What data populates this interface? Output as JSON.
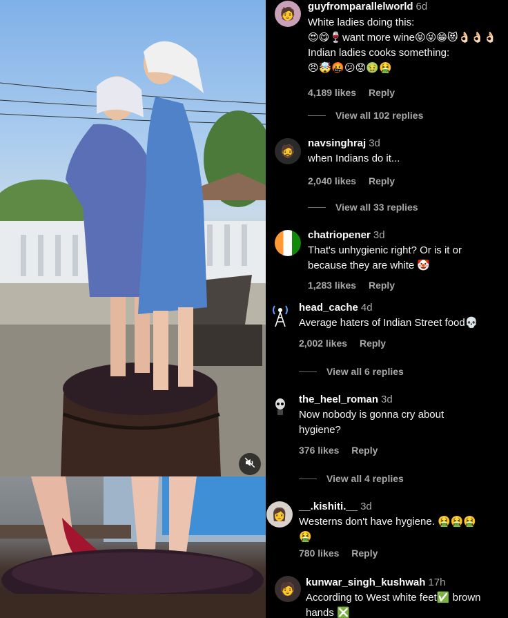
{
  "video": {
    "mute_icon": "speaker-muted-icon"
  },
  "comments": [
    {
      "username": "guyfromparallelworld",
      "time": "6d",
      "lines": [
        "White ladies doing this:",
        "😍😋🍷want more wine😝😜😁😻👌🏻👌🏻👌🏻",
        "Indian ladies cooks something:",
        "😠🤯🤬😕😟🤢🤮"
      ],
      "likes": "4,189 likes",
      "reply_label": "Reply",
      "view_replies": "View all 102 replies",
      "avatar_color": "#c8a0b8"
    },
    {
      "username": "navsinghraj",
      "time": "3d",
      "lines": [
        "when Indians do it..."
      ],
      "likes": "2,040 likes",
      "reply_label": "Reply",
      "view_replies": "View all 33 replies",
      "avatar_color": "#2a2a2a"
    },
    {
      "username": "chatriopener",
      "time": "3d",
      "lines": [
        "That's unhygienic right? Or is it or",
        "because they are white 🤡"
      ],
      "likes": "1,283 likes",
      "reply_label": "Reply",
      "avatar_color": "#ffffff"
    },
    {
      "username": "head_cache",
      "time": "4d",
      "lines": [
        "Average haters of Indian Street food💀"
      ],
      "likes": "2,002 likes",
      "reply_label": "Reply",
      "view_replies": "View all 6 replies",
      "avatar_color": "#000000"
    },
    {
      "username": "the_heel_roman",
      "time": "3d",
      "lines": [
        "Now nobody is gonna cry about",
        "hygiene?"
      ],
      "likes": "376 likes",
      "reply_label": "Reply",
      "view_replies": "View all 4 replies",
      "avatar_color": "#111111"
    },
    {
      "username": "__.kishiti.__",
      "time": "3d",
      "lines": [
        "Westerns don't have hygiene. 🤮🤮🤮",
        "🤮"
      ],
      "likes": "780 likes",
      "reply_label": "Reply",
      "avatar_color": "#d9d2cc"
    },
    {
      "username": "kunwar_singh_kushwah",
      "time": "17h",
      "lines": [
        "According to West white feet✅ brown",
        "hands ❎"
      ],
      "avatar_color": "#3a3030"
    }
  ]
}
